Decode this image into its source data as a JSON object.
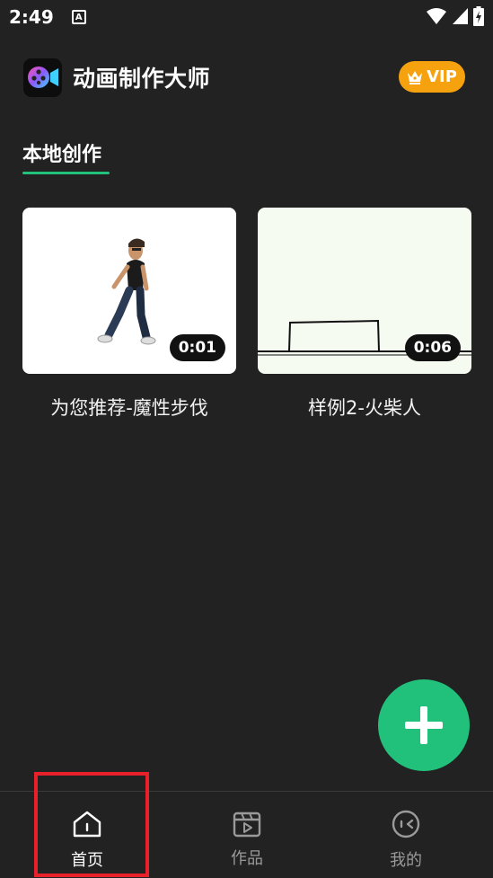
{
  "status_bar": {
    "time": "2:49",
    "notification_letter": "A"
  },
  "header": {
    "app_title": "动画制作大师",
    "vip_label": "VIP"
  },
  "section": {
    "tab_label": "本地创作"
  },
  "cards": [
    {
      "duration": "0:01",
      "caption": "为您推荐-魔性步伐"
    },
    {
      "duration": "0:06",
      "caption": "样例2-火柴人"
    }
  ],
  "bottom_nav": {
    "items": [
      {
        "label": "首页",
        "icon": "home-icon",
        "active": true
      },
      {
        "label": "作品",
        "icon": "clapperboard-icon",
        "active": false
      },
      {
        "label": "我的",
        "icon": "profile-face-icon",
        "active": false
      }
    ]
  },
  "colors": {
    "background": "#222222",
    "accent_green": "#21c17c",
    "vip_orange": "#f6a10e",
    "highlight_red": "#e8202a"
  }
}
